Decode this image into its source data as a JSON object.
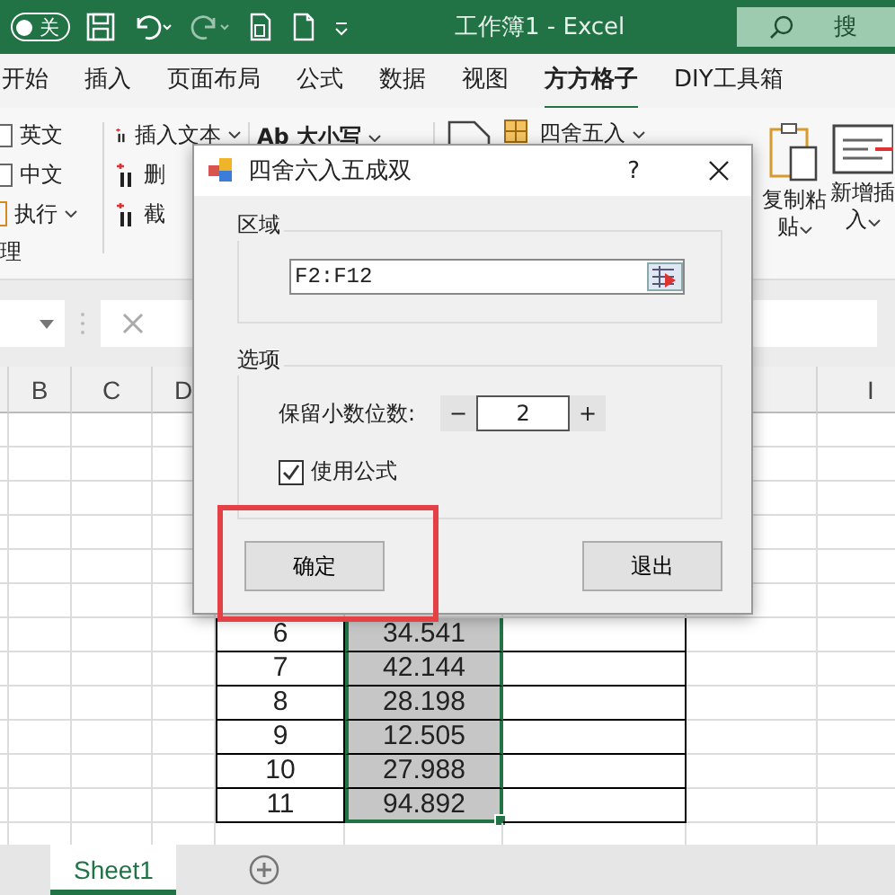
{
  "title_bar": {
    "autosave": {
      "label": "关",
      "on": false
    },
    "title": "工作簿1 - Excel",
    "search_placeholder": "搜"
  },
  "ribbon_tabs": [
    {
      "label": "开始",
      "selected": false
    },
    {
      "label": "插入",
      "selected": false
    },
    {
      "label": "页面布局",
      "selected": false
    },
    {
      "label": "公式",
      "selected": false
    },
    {
      "label": "数据",
      "selected": false
    },
    {
      "label": "视图",
      "selected": false
    },
    {
      "label": "方方格子",
      "selected": true
    },
    {
      "label": "DIY工具箱",
      "selected": false
    }
  ],
  "ribbon": {
    "language_options": [
      {
        "label": "英文",
        "checked": false
      },
      {
        "label": "中文",
        "checked": false
      }
    ],
    "run_button": "执行",
    "group_label": "理",
    "text_tools": [
      "插入文本",
      "删",
      "截"
    ],
    "case_button": "Ab 大小写",
    "round_button": "四舍五入",
    "copy_paste": [
      "复制粘",
      "贴"
    ],
    "insert_new": [
      "新增插",
      "入"
    ]
  },
  "column_headers": [
    "B",
    "C",
    "D",
    "I"
  ],
  "rows": [
    {
      "number": "6",
      "value": "34.541",
      "selected": true
    },
    {
      "number": "7",
      "value": "42.144",
      "selected": true
    },
    {
      "number": "8",
      "value": "28.198",
      "selected": true
    },
    {
      "number": "9",
      "value": "12.505",
      "selected": true
    },
    {
      "number": "10",
      "value": "27.988",
      "selected": true
    },
    {
      "number": "11",
      "value": "94.892",
      "selected": true
    }
  ],
  "sheet_tabs": [
    {
      "label": "Sheet1",
      "selected": true
    }
  ],
  "dialog": {
    "title": "四舍六入五成双",
    "help": "?",
    "range_group": {
      "label": "区域",
      "value": "F2:F12"
    },
    "options_group": {
      "label": "选项",
      "decimals_label": "保留小数位数:",
      "minus": "−",
      "decimals": "2",
      "plus": "+",
      "use_formula": {
        "label": "使用公式",
        "checked": true
      }
    },
    "buttons": [
      {
        "label": "确定",
        "highlighted": true
      },
      {
        "label": "退出",
        "highlighted": false
      }
    ]
  }
}
